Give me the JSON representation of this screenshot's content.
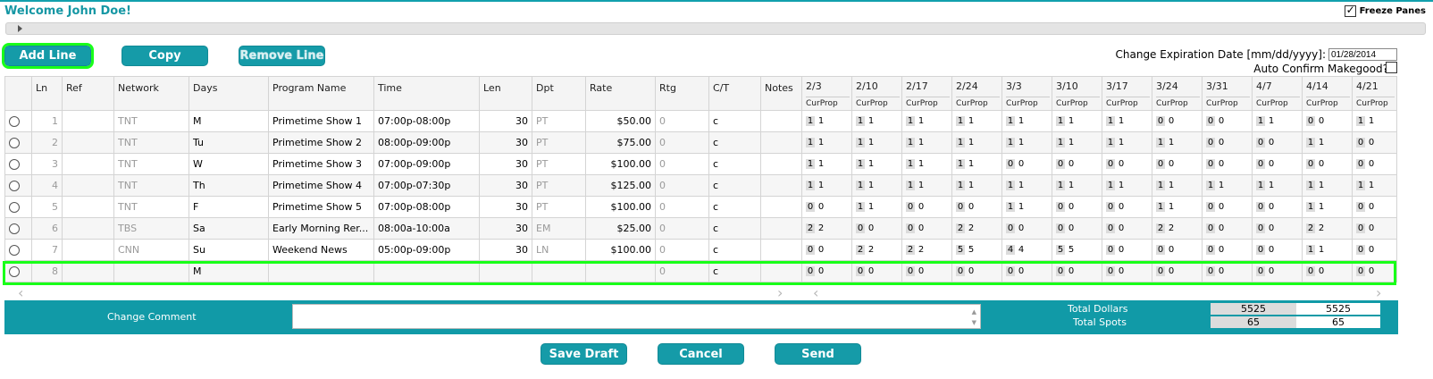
{
  "header": {
    "welcome": "Welcome John Doe!",
    "freeze_label": "Freeze Panes",
    "freeze_checked": true
  },
  "toolbar": {
    "add_line": "Add Line",
    "copy": "Copy",
    "remove_line": "Remove Line"
  },
  "expiration": {
    "label": "Change Expiration Date [mm/dd/yyyy]:",
    "value": "01/28/2014",
    "auto_confirm_label": "Auto Confirm Makegood?:",
    "auto_confirm_checked": false
  },
  "table": {
    "columns": [
      "Ln",
      "Ref",
      "Network",
      "Days",
      "Program Name",
      "Time",
      "Len",
      "Dpt",
      "Rate",
      "Rtg",
      "C/T",
      "Notes"
    ],
    "weeks": [
      "2/3",
      "2/10",
      "2/17",
      "2/24",
      "3/3",
      "3/10",
      "3/17",
      "3/24",
      "3/31",
      "4/7",
      "4/14",
      "4/21"
    ],
    "week_sub": "CurProp",
    "rows": [
      {
        "ln": "1",
        "ref": "",
        "network": "TNT",
        "days": "M",
        "program": "Primetime Show 1",
        "time": "07:00p-08:00p",
        "len": "30",
        "dpt": "PT",
        "rate": "$50.00",
        "rtg": "0",
        "ct": "c",
        "notes": "",
        "weeks": [
          [
            "1",
            "1"
          ],
          [
            "1",
            "1"
          ],
          [
            "1",
            "1"
          ],
          [
            "1",
            "1"
          ],
          [
            "1",
            "1"
          ],
          [
            "1",
            "1"
          ],
          [
            "1",
            "1"
          ],
          [
            "0",
            "0"
          ],
          [
            "0",
            "0"
          ],
          [
            "1",
            "1"
          ],
          [
            "0",
            "0"
          ],
          [
            "1",
            "1"
          ]
        ]
      },
      {
        "ln": "2",
        "ref": "",
        "network": "TNT",
        "days": "Tu",
        "program": "Primetime Show 2",
        "time": "08:00p-09:00p",
        "len": "30",
        "dpt": "PT",
        "rate": "$75.00",
        "rtg": "0",
        "ct": "c",
        "notes": "",
        "weeks": [
          [
            "1",
            "1"
          ],
          [
            "1",
            "1"
          ],
          [
            "1",
            "1"
          ],
          [
            "1",
            "1"
          ],
          [
            "1",
            "1"
          ],
          [
            "1",
            "1"
          ],
          [
            "1",
            "1"
          ],
          [
            "1",
            "1"
          ],
          [
            "0",
            "0"
          ],
          [
            "0",
            "0"
          ],
          [
            "1",
            "1"
          ],
          [
            "0",
            "0"
          ]
        ]
      },
      {
        "ln": "3",
        "ref": "",
        "network": "TNT",
        "days": "W",
        "program": "Primetime Show 3",
        "time": "07:00p-09:00p",
        "len": "30",
        "dpt": "PT",
        "rate": "$100.00",
        "rtg": "0",
        "ct": "c",
        "notes": "",
        "weeks": [
          [
            "1",
            "1"
          ],
          [
            "1",
            "1"
          ],
          [
            "1",
            "1"
          ],
          [
            "1",
            "1"
          ],
          [
            "0",
            "0"
          ],
          [
            "0",
            "0"
          ],
          [
            "0",
            "0"
          ],
          [
            "0",
            "0"
          ],
          [
            "0",
            "0"
          ],
          [
            "0",
            "0"
          ],
          [
            "0",
            "0"
          ],
          [
            "0",
            "0"
          ]
        ]
      },
      {
        "ln": "4",
        "ref": "",
        "network": "TNT",
        "days": "Th",
        "program": "Primetime Show 4",
        "time": "07:00p-07:30p",
        "len": "30",
        "dpt": "PT",
        "rate": "$125.00",
        "rtg": "0",
        "ct": "c",
        "notes": "",
        "weeks": [
          [
            "1",
            "1"
          ],
          [
            "1",
            "1"
          ],
          [
            "1",
            "1"
          ],
          [
            "1",
            "1"
          ],
          [
            "1",
            "1"
          ],
          [
            "1",
            "1"
          ],
          [
            "1",
            "1"
          ],
          [
            "1",
            "1"
          ],
          [
            "1",
            "1"
          ],
          [
            "1",
            "1"
          ],
          [
            "1",
            "1"
          ],
          [
            "1",
            "1"
          ]
        ]
      },
      {
        "ln": "5",
        "ref": "",
        "network": "TNT",
        "days": "F",
        "program": "Primetime Show 5",
        "time": "07:00p-08:00p",
        "len": "30",
        "dpt": "PT",
        "rate": "$100.00",
        "rtg": "0",
        "ct": "c",
        "notes": "",
        "weeks": [
          [
            "0",
            "0"
          ],
          [
            "1",
            "1"
          ],
          [
            "0",
            "0"
          ],
          [
            "0",
            "0"
          ],
          [
            "1",
            "1"
          ],
          [
            "0",
            "0"
          ],
          [
            "0",
            "0"
          ],
          [
            "1",
            "1"
          ],
          [
            "0",
            "0"
          ],
          [
            "0",
            "0"
          ],
          [
            "1",
            "1"
          ],
          [
            "0",
            "0"
          ]
        ]
      },
      {
        "ln": "6",
        "ref": "",
        "network": "TBS",
        "days": "Sa",
        "program": "Early Morning Rer...",
        "time": "08:00a-10:00a",
        "len": "30",
        "dpt": "EM",
        "rate": "$25.00",
        "rtg": "0",
        "ct": "c",
        "notes": "",
        "weeks": [
          [
            "2",
            "2"
          ],
          [
            "0",
            "0"
          ],
          [
            "0",
            "0"
          ],
          [
            "2",
            "2"
          ],
          [
            "0",
            "0"
          ],
          [
            "0",
            "0"
          ],
          [
            "0",
            "0"
          ],
          [
            "2",
            "2"
          ],
          [
            "0",
            "0"
          ],
          [
            "0",
            "0"
          ],
          [
            "2",
            "2"
          ],
          [
            "0",
            "0"
          ]
        ]
      },
      {
        "ln": "7",
        "ref": "",
        "network": "CNN",
        "days": "Su",
        "program": "Weekend News",
        "time": "05:00p-09:00p",
        "len": "30",
        "dpt": "LN",
        "rate": "$100.00",
        "rtg": "0",
        "ct": "c",
        "notes": "",
        "weeks": [
          [
            "0",
            "0"
          ],
          [
            "2",
            "2"
          ],
          [
            "2",
            "2"
          ],
          [
            "5",
            "5"
          ],
          [
            "4",
            "4"
          ],
          [
            "5",
            "5"
          ],
          [
            "0",
            "0"
          ],
          [
            "0",
            "0"
          ],
          [
            "0",
            "0"
          ],
          [
            "0",
            "0"
          ],
          [
            "1",
            "1"
          ],
          [
            "0",
            "0"
          ]
        ]
      },
      {
        "ln": "8",
        "ref": "",
        "network": "",
        "days": "M",
        "program": "",
        "time": "",
        "len": "",
        "dpt": "",
        "rate": "",
        "rtg": "0",
        "ct": "c",
        "notes": "",
        "weeks": [
          [
            "0",
            "0"
          ],
          [
            "0",
            "0"
          ],
          [
            "0",
            "0"
          ],
          [
            "0",
            "0"
          ],
          [
            "0",
            "0"
          ],
          [
            "0",
            "0"
          ],
          [
            "0",
            "0"
          ],
          [
            "0",
            "0"
          ],
          [
            "0",
            "0"
          ],
          [
            "0",
            "0"
          ],
          [
            "0",
            "0"
          ],
          [
            "0",
            "0"
          ]
        ]
      }
    ]
  },
  "footer": {
    "change_comment_label": "Change Comment",
    "change_comment_value": "",
    "total_dollars_label": "Total Dollars",
    "total_dollars_cur": "5525",
    "total_dollars_prop": "5525",
    "total_spots_label": "Total Spots",
    "total_spots_cur": "65",
    "total_spots_prop": "65"
  },
  "actions": {
    "save_draft": "Save Draft",
    "cancel": "Cancel",
    "send": "Send"
  },
  "colors": {
    "accent": "#159ba8",
    "highlight": "#19ff19"
  }
}
